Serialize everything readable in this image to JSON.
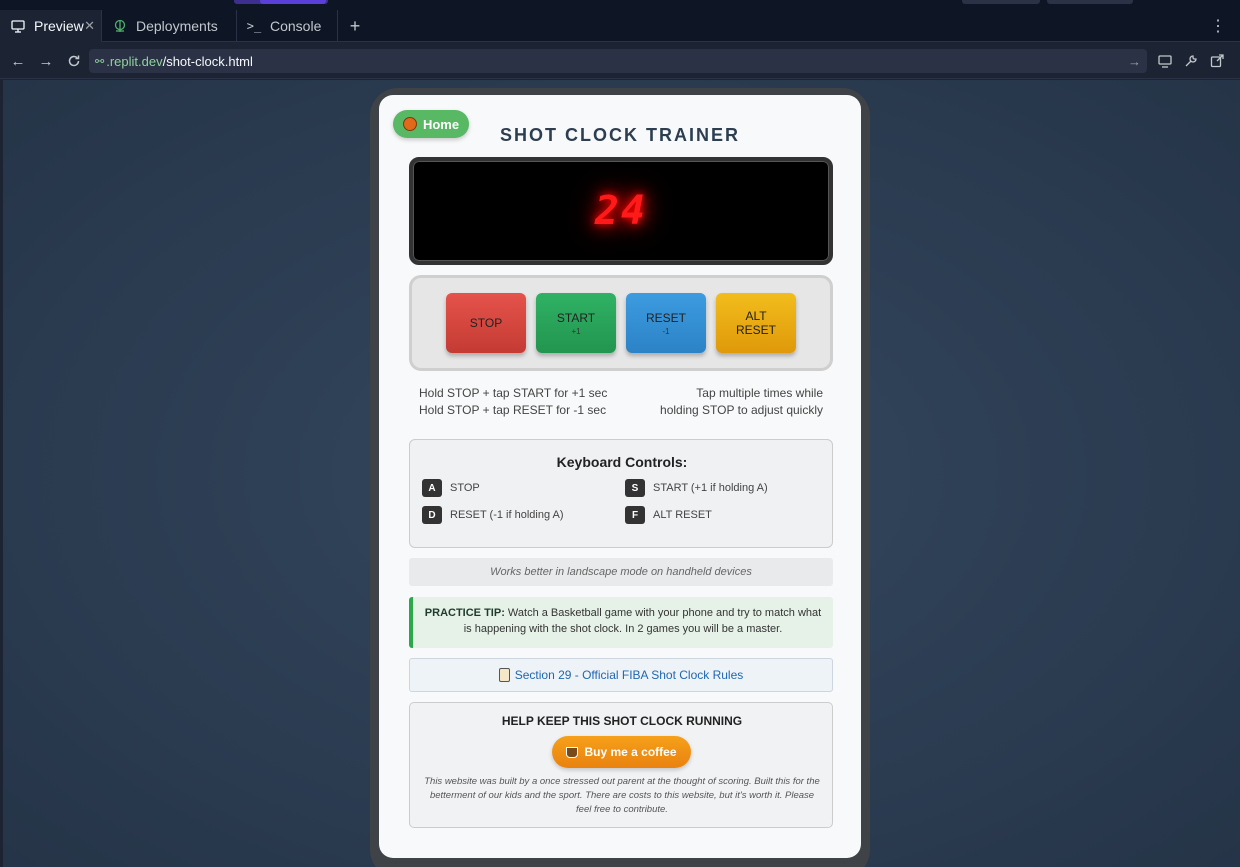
{
  "tabs": {
    "preview": "Preview",
    "deployments": "Deployments",
    "console": "Console"
  },
  "url": {
    "domain": ".replit.dev",
    "path": "/shot-clock.html"
  },
  "page": {
    "home_label": "Home",
    "title": "SHOT CLOCK TRAINER",
    "clock_value": "24",
    "buttons": {
      "stop": "STOP",
      "start": "START",
      "start_sub": "+1",
      "reset": "RESET",
      "reset_sub": "-1",
      "alt_line1": "ALT",
      "alt_line2": "RESET"
    },
    "hints": {
      "left1": "Hold STOP + tap START for +1 sec",
      "left2": "Hold STOP + tap RESET for -1 sec",
      "right1": "Tap multiple times while",
      "right2": "holding STOP to adjust quickly"
    },
    "keyboard": {
      "title": "Keyboard Controls:",
      "items": [
        {
          "key": "A",
          "label": "STOP"
        },
        {
          "key": "S",
          "label": "START (+1 if holding A)"
        },
        {
          "key": "D",
          "label": "RESET (-1 if holding A)"
        },
        {
          "key": "F",
          "label": "ALT RESET"
        }
      ]
    },
    "landscape_note": "Works better in landscape mode on handheld devices",
    "tip": {
      "label": "PRACTICE TIP:",
      "text": "Watch a Basketball game with your phone and try to match what is happening with the shot clock. In 2 games you will be a master."
    },
    "fiba_link": "Section 29 - Official FIBA Shot Clock Rules",
    "coffee": {
      "title": "HELP KEEP THIS SHOT CLOCK RUNNING",
      "button": "Buy me a coffee",
      "text": "This website was built by a once stressed out parent at the thought of scoring. Built this for the betterment of our kids and the sport. There are costs to this website, but it's worth it. Please feel free to contribute."
    }
  },
  "colors": {
    "clock_red": "#ff1a1a",
    "home_green": "#58b864",
    "stop_red": "#e5534b",
    "start_green": "#2fb264",
    "reset_blue": "#3d9be0",
    "alt_yellow": "#f2bd1c",
    "coffee_orange": "#f6a01a",
    "url_domain_green": "#8fd49b"
  },
  "icons": {
    "preview": "monitor-icon",
    "deployments": "rocket-icon",
    "console": "terminal-icon",
    "home": "basketball-icon",
    "fiba": "clipboard-icon",
    "coffee": "coffee-cup-icon"
  }
}
